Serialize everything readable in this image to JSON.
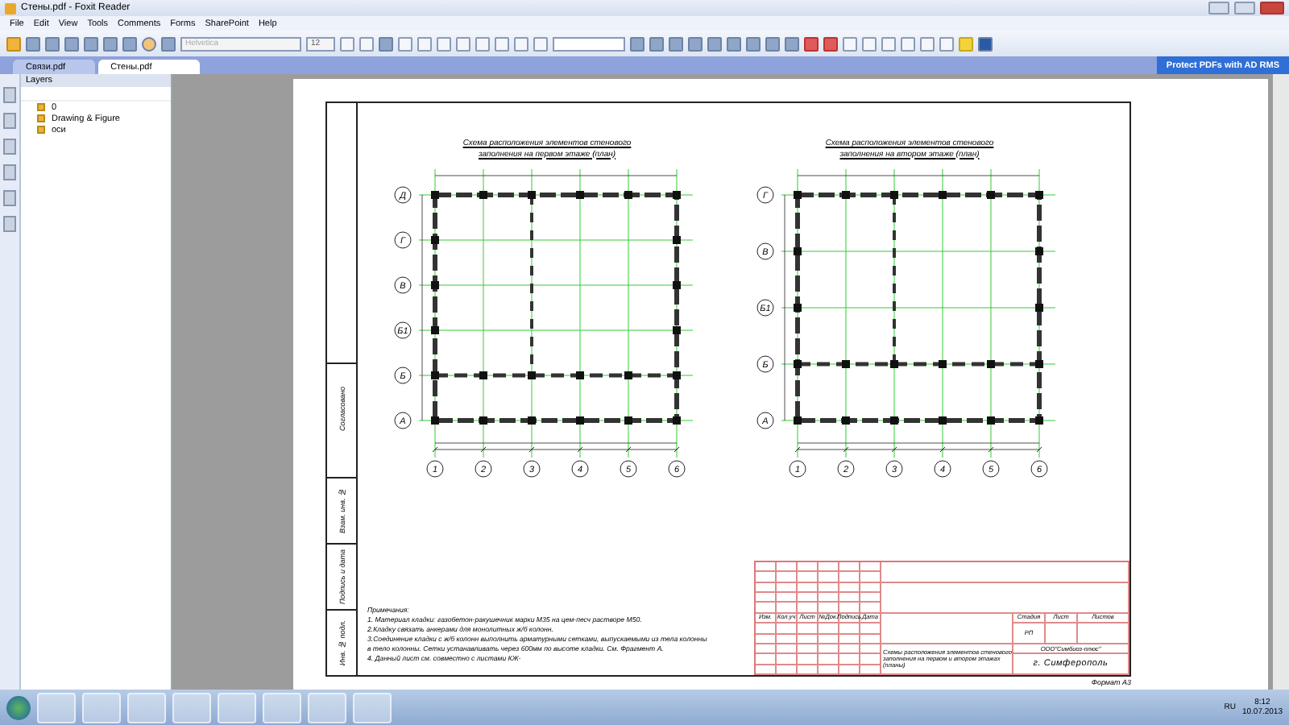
{
  "window": {
    "title": "Стены.pdf - Foxit Reader"
  },
  "menu": [
    "File",
    "Edit",
    "View",
    "Tools",
    "Comments",
    "Forms",
    "SharePoint",
    "Help"
  ],
  "toolbar": {
    "font_field": {
      "placeholder": "Helvetica"
    },
    "size_field": {
      "value": "12"
    }
  },
  "tabs": [
    {
      "label": "Связи.pdf",
      "selected": false
    },
    {
      "label": "Стены.pdf",
      "selected": true
    }
  ],
  "banner": "Protect PDFs with AD RMS",
  "layers_panel": {
    "title": "Layers",
    "items": [
      {
        "label": "0",
        "checked": true
      },
      {
        "label": "Drawing & Figure",
        "checked": true
      },
      {
        "label": "оси",
        "checked": true
      }
    ]
  },
  "document": {
    "plans": [
      {
        "title": "Схема расположения элементов стенового заполнения на первом этаже (план)",
        "row_axes": [
          "Д",
          "Г",
          "В",
          "Б1",
          "Б",
          "А"
        ],
        "col_axes": [
          "1",
          "2",
          "3",
          "4",
          "5",
          "6"
        ]
      },
      {
        "title": "Схема расположения элементов стенового заполнения на втором этаже (план)",
        "row_axes": [
          "Г",
          "В",
          "Б1",
          "Б",
          "А"
        ],
        "col_axes": [
          "1",
          "2",
          "3",
          "4",
          "5",
          "6"
        ]
      }
    ],
    "stamp": [
      "Согласовано",
      "Взам. инв. №",
      "Подпись и дата",
      "Инв. № подл."
    ],
    "notes": {
      "heading": "Примечания:",
      "lines": [
        "1. Материал кладки: газобетон-ракушечник марки М35 на цем-песч растворе М50.",
        "2.Кладку связать анкерами для монолитных ж/б колонн.",
        "3.Соединение кладки с ж/б колонн выполнить арматурными сетками, выпускаемыми из тела колонны",
        "в тело колонны. Сетки устанавливать через 600мм по высоте кладки. См. Фрагмент А.",
        "4. Данный лист см. совместно с листами КЖ-"
      ]
    },
    "title_block": {
      "columns": [
        "Изм.",
        "Кол.уч",
        "Лист",
        "№Док.",
        "Подпись",
        "Дата"
      ],
      "stage_headers": [
        "Стадия",
        "Лист",
        "Листов"
      ],
      "stage": "РП",
      "description": "Схемы расположения элементов стенового заполнения на первом и втором этажах (планы)",
      "company": "ООО\"Симбиоз-плюс\"",
      "city": "г. Симферополь"
    },
    "format": "Формат А3"
  },
  "taskbar": {
    "language": "RU",
    "time": "8:12",
    "date": "10.07.2013"
  }
}
